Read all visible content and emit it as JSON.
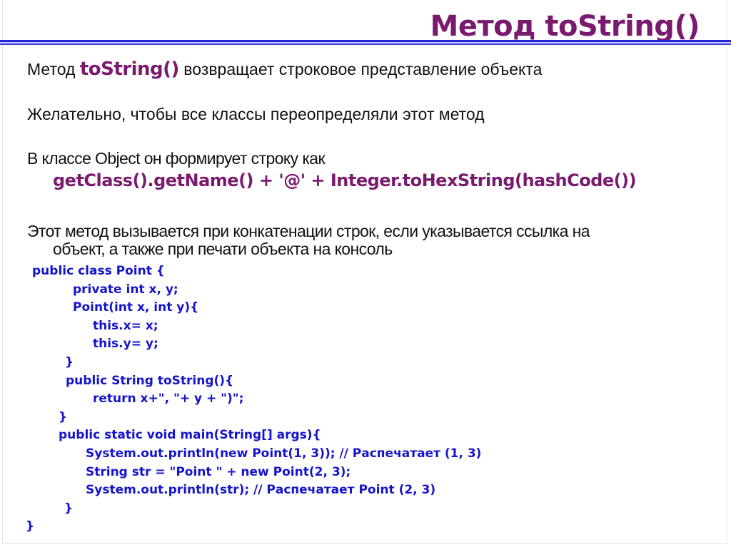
{
  "slide": {
    "title": "Метод toString()",
    "paragraphs": {
      "p1_prefix": "Метод ",
      "p1_keyword": "toString()",
      "p1_suffix": " возвращает строковое представление объекта",
      "p2": "Желательно, чтобы все классы переопределяли этот метод",
      "p3": "В классе Object он формирует строку как",
      "formula": "getClass().getName() + '@' + Integer.toHexString(hashCode())",
      "p4_line1": "Этот метод вызывается при конкатенации строк, если указывается ссылка на",
      "p4_line2": "объект, а также при печати объекта на консоль"
    },
    "code_lines": [
      "public class Point {",
      "private int x, y;",
      "Point(int x, int y){",
      "this.x= x;",
      "this.y= y;",
      "}",
      "public String toString(){",
      "return x+\", \"+ y + \")\";",
      "}",
      "public static void main(String[] args){",
      "System.out.println(new Point(1, 3)); // Распечатает (1, 3)",
      "String str = \"Point \" + new Point(2, 3);",
      "System.out.println(str); // Распечатает Point (2, 3)",
      "}",
      "}"
    ],
    "colors": {
      "title": "#7a1a6e",
      "code": "#1414cc",
      "rule": "#2424d8",
      "body_text": "#111111"
    }
  }
}
